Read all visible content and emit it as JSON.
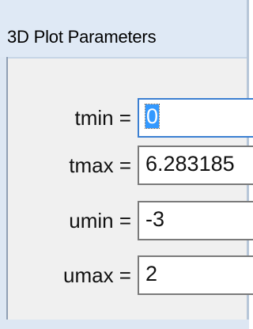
{
  "window": {
    "title": "3D Plot Parameters"
  },
  "fields": [
    {
      "label": "tmin =",
      "value": "0",
      "selected": true
    },
    {
      "label": "tmax =",
      "value": "6.283185",
      "selected": false
    },
    {
      "label": "umin =",
      "value": "-3",
      "selected": false
    },
    {
      "label": "umax =",
      "value": "2",
      "selected": false
    }
  ],
  "colors": {
    "titlebar": "#dfe9f5",
    "client": "#f0f0f0",
    "selection": "#3399ff"
  }
}
